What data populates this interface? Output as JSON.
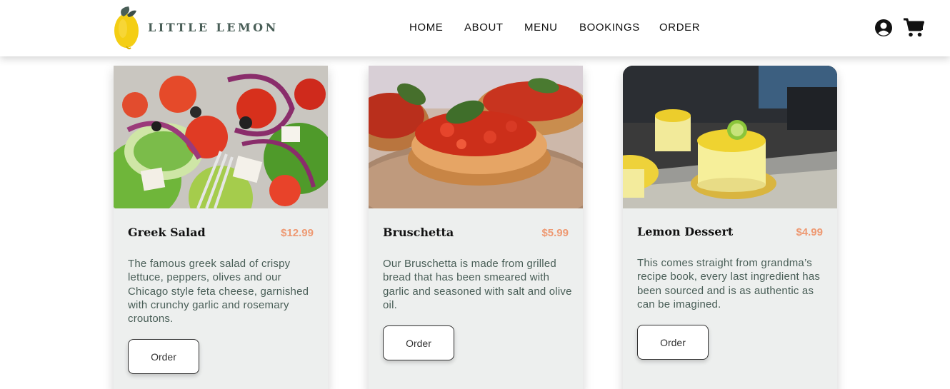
{
  "brand": {
    "name": "LITTLE LEMON",
    "logo_icon": "lemon-logo-icon"
  },
  "nav": {
    "items": [
      {
        "label": "HOME"
      },
      {
        "label": "ABOUT"
      },
      {
        "label": "MENU"
      },
      {
        "label": "BOOKINGS"
      },
      {
        "label": "ORDER"
      }
    ]
  },
  "header_icons": {
    "user_icon": "user-circle-icon",
    "cart_icon": "shopping-cart-icon"
  },
  "colors": {
    "primary_green": "#495e57",
    "accent_peach": "#ee9972",
    "card_bg": "#edefee"
  },
  "specials": [
    {
      "title": "Greek Salad",
      "price": "$12.99",
      "description": "The famous greek salad of crispy lettuce, peppers, olives and our Chicago style feta cheese, garnished with crunchy garlic and rosemary croutons.",
      "button": "Order",
      "image": "greek-salad-photo"
    },
    {
      "title": "Bruschetta",
      "price": "$5.99",
      "description": "Our Bruschetta is made from grilled bread that has been smeared with garlic and seasoned with salt and olive oil.",
      "button": "Order",
      "image": "bruschetta-photo"
    },
    {
      "title": "Lemon Dessert",
      "price": "$4.99",
      "description": "This comes straight from grandma’s recipe book, every last ingredient has been sourced and is as authentic as can be imagined.",
      "button": "Order",
      "image": "lemon-dessert-photo"
    }
  ]
}
